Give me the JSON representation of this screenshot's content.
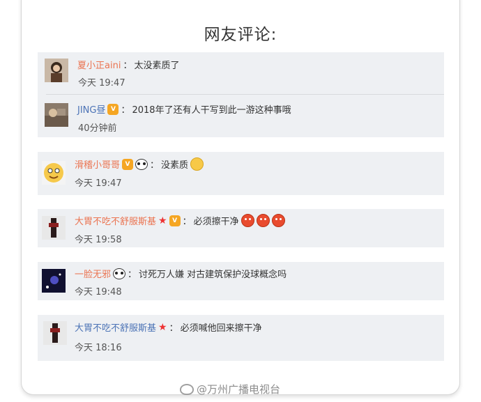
{
  "heading": "网友评论:",
  "comments": [
    {
      "name": "夏小正aini",
      "text": "太没素质了",
      "time": "今天 19:47"
    },
    {
      "name": "JING昼",
      "text": "2018年了还有人干写到此一游这种事哦",
      "time": "40分钟前"
    },
    {
      "name": "滑稽小哥哥",
      "text": "没素质",
      "time": "今天 19:47"
    },
    {
      "name": "大胃不吃不舒服斯基",
      "text": "必须擦干净",
      "time": "今天 19:58"
    },
    {
      "name": "一脸无邪",
      "text": "讨死万人嫌 对古建筑保护没球概念吗",
      "time": "今天 19:48"
    },
    {
      "name": "大胃不吃不舒服斯基",
      "text": "必须喊他回来擦干净",
      "time": "今天 18:16"
    }
  ],
  "colon": "：",
  "badge_text": "V",
  "footer": "@万州广播电视台",
  "colors": {
    "name_orange": "#eb7350",
    "name_blue": "#4c73b6",
    "block_bg": "#eef0f3"
  },
  "icons": {
    "badge": "vip-badge-icon",
    "panda": "panda-emoji-icon",
    "star": "star-icon",
    "angry": "angry-face-emoji-icon",
    "smile": "smile-emoji-icon",
    "weibo": "weibo-logo-icon"
  }
}
